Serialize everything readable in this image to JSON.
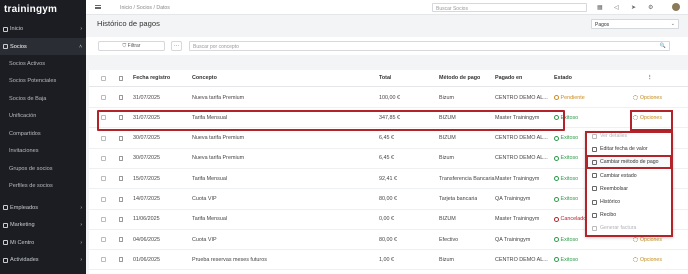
{
  "brand": "trainingym",
  "colors": {
    "accent": "#c48a1a",
    "highlight": "#b3242a",
    "ok": "#2e9a4a",
    "pending": "#d08a1a",
    "cancel": "#b3242a"
  },
  "sidebar": {
    "items": [
      {
        "label": "Inicio",
        "icon": "home-icon",
        "chevron": "›",
        "active": false
      },
      {
        "label": "Socios",
        "icon": "users-icon",
        "chevron": "˄",
        "active": true
      }
    ],
    "subitems": [
      "Socios Activos",
      "Socios Potenciales",
      "Socios de Baja",
      "Unificación",
      "Compartidos",
      "Invitaciones",
      "Grupos de socios",
      "Perfiles de socios"
    ],
    "bottom": [
      {
        "label": "Empleados",
        "icon": "employee-icon",
        "chevron": "›"
      },
      {
        "label": "Marketing",
        "icon": "megaphone-icon",
        "chevron": "›"
      },
      {
        "label": "Mi Centro",
        "icon": "building-icon",
        "chevron": "›"
      },
      {
        "label": "Actividades",
        "icon": "calendar-icon",
        "chevron": "›"
      }
    ]
  },
  "topbar": {
    "breadcrumb": "Inicio  /  Socios  /  Datos",
    "search_placeholder": "Buscar Socios"
  },
  "page": {
    "title": "Histórico de pagos",
    "select_value": "Pagos",
    "select_caret": "⌄"
  },
  "filters": {
    "filter_label": "Filtrar",
    "more_label": "···",
    "search_placeholder": "Buscar por concepto",
    "search_icon": "🔍"
  },
  "table": {
    "headers": [
      "Fecha registro",
      "Concepto",
      "Total",
      "Método de pago",
      "Pagado en",
      "Estado",
      "⋮"
    ],
    "rows": [
      {
        "date": "31/07/2025",
        "concept": "Nueva tarifa Premium",
        "total": "100,00 €",
        "method": "Bizum",
        "paid_in": "CENTRO DEMO AL...",
        "status": "Pendiente",
        "status_type": "pending",
        "options": "Opciones"
      },
      {
        "date": "31/07/2025",
        "concept": "Tarifa Mensual",
        "total": "347,85 €",
        "method": "BIZUM",
        "paid_in": "Master Trainingym",
        "status": "Exitoso",
        "status_type": "ok",
        "options": "Opciones"
      },
      {
        "date": "30/07/2025",
        "concept": "Nueva tarifa Premium",
        "total": "6,45 €",
        "method": "BIZUM",
        "paid_in": "CENTRO DEMO AL...",
        "status": "Exitoso",
        "status_type": "ok",
        "options": ""
      },
      {
        "date": "30/07/2025",
        "concept": "Nueva tarifa Premium",
        "total": "6,45 €",
        "method": "Bizum",
        "paid_in": "CENTRO DEMO AL...",
        "status": "Exitoso",
        "status_type": "ok",
        "options": ""
      },
      {
        "date": "15/07/2025",
        "concept": "Tarifa Mensual",
        "total": "92,41 €",
        "method": "Transferencia Bancaria",
        "paid_in": "Master Trainingym",
        "status": "Exitoso",
        "status_type": "ok",
        "options": ""
      },
      {
        "date": "14/07/2025",
        "concept": "Cuota VIP",
        "total": "80,00 €",
        "method": "Tarjeta bancaria",
        "paid_in": "QA Trainingym",
        "status": "Exitoso",
        "status_type": "ok",
        "options": ""
      },
      {
        "date": "11/06/2025",
        "concept": "Tarifa Mensual",
        "total": "0,00 €",
        "method": "BIZUM",
        "paid_in": "Master Trainingym",
        "status": "Cancelado",
        "status_type": "cancel",
        "options": ""
      },
      {
        "date": "04/06/2025",
        "concept": "Cuota VIP",
        "total": "80,00 €",
        "method": "Efectivo",
        "paid_in": "QA Trainingym",
        "status": "Exitoso",
        "status_type": "ok",
        "options": "Opciones"
      },
      {
        "date": "01/06/2025",
        "concept": "Prueba reservas meses futuros",
        "total": "1,00 €",
        "method": "Bizum",
        "paid_in": "CENTRO DEMO AL...",
        "status": "Exitoso",
        "status_type": "ok",
        "options": "Opciones"
      }
    ]
  },
  "dropdown": {
    "items": [
      {
        "label": "Ver detalles",
        "icon": "eye-icon",
        "state": "faded"
      },
      {
        "label": "Editar fecha de valor",
        "icon": "pencil-icon",
        "state": "normal"
      },
      {
        "label": "Cambiar método de pago",
        "icon": "card-icon",
        "state": "highlighted"
      },
      {
        "label": "Cambiar estado",
        "icon": "refresh-icon",
        "state": "normal"
      },
      {
        "label": "Reembolsar",
        "icon": "undo-icon",
        "state": "normal"
      },
      {
        "label": "Histórico",
        "icon": "history-icon",
        "state": "normal"
      },
      {
        "label": "Recibo",
        "icon": "receipt-icon",
        "state": "normal"
      },
      {
        "label": "Generar factura",
        "icon": "invoice-icon",
        "state": "faded"
      }
    ]
  }
}
